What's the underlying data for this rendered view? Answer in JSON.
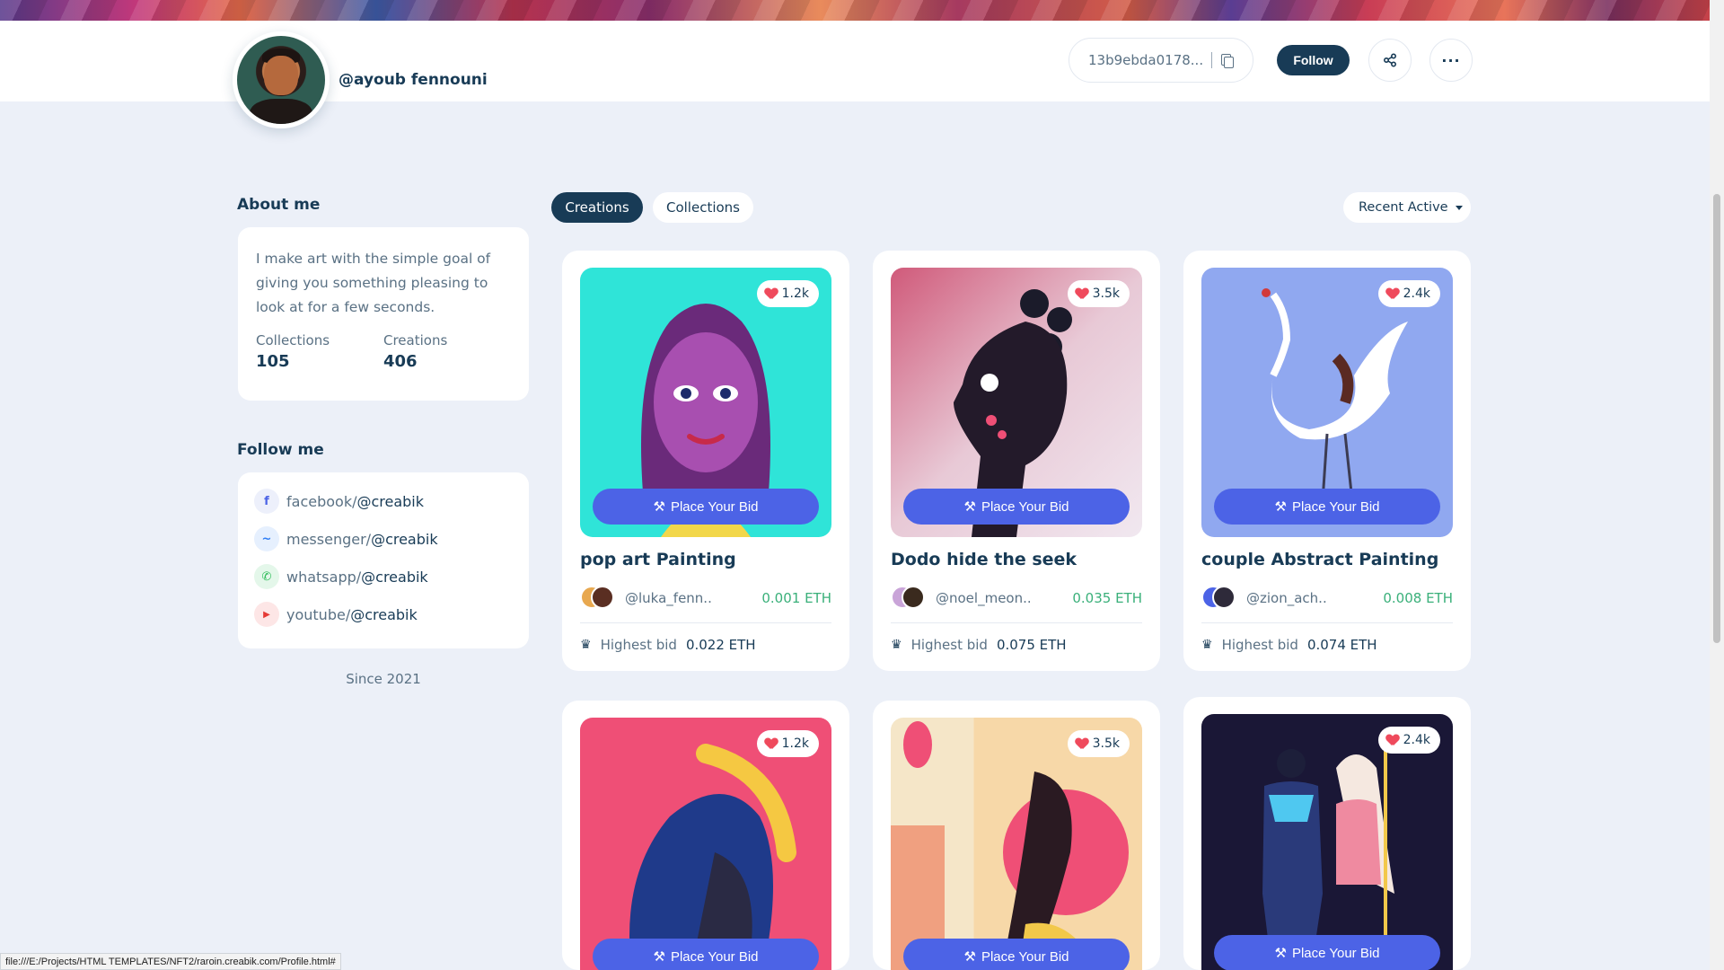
{
  "profile": {
    "username": "@ayoub fennouni",
    "wallet_address": "13b9ebda0178...",
    "follow_label": "Follow",
    "share_icon": "share-icon",
    "more_label": "···"
  },
  "about": {
    "title": "About me",
    "text": "I make art with the simple goal of giving you something pleasing to look at for a few seconds.",
    "collections_label": "Collections",
    "collections_value": "105",
    "creations_label": "Creations",
    "creations_value": "406"
  },
  "follow_me": {
    "title": "Follow me",
    "items": [
      {
        "network": "facebook/",
        "handle": "@creabik",
        "icon": "facebook-icon",
        "glyph": "f",
        "color": "#4c63e6",
        "bg": "#edf0fb"
      },
      {
        "network": "messenger/",
        "handle": "@creabik",
        "icon": "messenger-icon",
        "glyph": "~",
        "color": "#2f7ef5",
        "bg": "#e6f0fe"
      },
      {
        "network": "whatsapp/",
        "handle": "@creabik",
        "icon": "whatsapp-icon",
        "glyph": "✆",
        "color": "#2ebd59",
        "bg": "#e4f7ea"
      },
      {
        "network": "youtube/",
        "handle": "@creabik",
        "icon": "youtube-icon",
        "glyph": "▶",
        "color": "#e53935",
        "bg": "#fde6e6"
      }
    ],
    "since": "Since 2021"
  },
  "tabs": [
    {
      "label": "Creations",
      "active": true
    },
    {
      "label": "Collections",
      "active": false
    }
  ],
  "sort": {
    "label": "Recent Active"
  },
  "bid_button_label": "Place Your Bid",
  "highest_bid_label": "Highest bid",
  "cards": [
    {
      "title": "pop art Painting",
      "likes": "1.2k",
      "creator": "@luka_fenn..",
      "price": "0.001 ETH",
      "highest_bid": "0.022 ETH"
    },
    {
      "title": "Dodo hide the seek",
      "likes": "3.5k",
      "creator": "@noel_meon..",
      "price": "0.035 ETH",
      "highest_bid": "0.075 ETH"
    },
    {
      "title": "couple Abstract Painting",
      "likes": "2.4k",
      "creator": "@zion_ach..",
      "price": "0.008 ETH",
      "highest_bid": "0.074 ETH"
    },
    {
      "likes": "1.2k"
    },
    {
      "likes": "3.5k"
    },
    {
      "likes": "2.4k"
    }
  ],
  "status_bar_url": "file:///E:/Projects/HTML TEMPLATES/NFT2/raroin.creabik.com/Profile.html#",
  "colors": {
    "primary": "#183b56",
    "accent": "#4c63e6",
    "price": "#3ab07a",
    "like": "#ef4a5c"
  }
}
